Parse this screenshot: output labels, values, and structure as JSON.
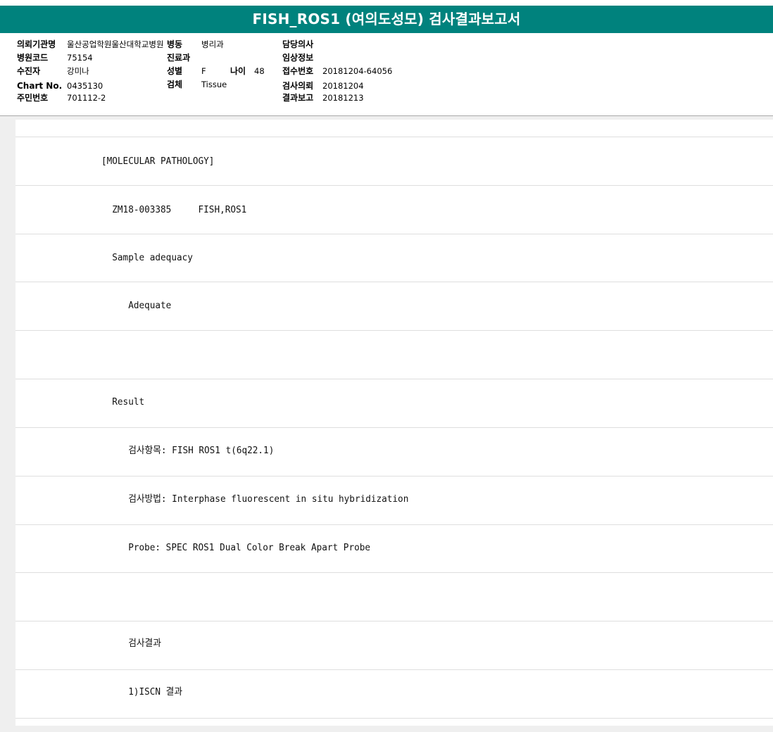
{
  "report": {
    "title": "FISH_ROS1 (여의도성모) 검사결과보고서",
    "header": {
      "col1": [
        {
          "label": "의뢰기관명",
          "value": "울산공업학원울산대학교병원"
        },
        {
          "label": "병원코드",
          "value": "75154"
        },
        {
          "label": "수진자",
          "value": "강미나"
        },
        {
          "label": "Chart No.",
          "value": "0435130"
        },
        {
          "label": "주민번호",
          "value": "701112-2"
        }
      ],
      "col2": {
        "dept_label": "병동",
        "dept_value": "병리과",
        "clinic_label": "진료과",
        "sex_label": "성별",
        "sex_value": "F",
        "age_label": "나이",
        "age_value": "48",
        "specimen_label": "검체",
        "specimen_value": "Tissue"
      },
      "col3": [
        {
          "label": "담당의사",
          "value": ""
        },
        {
          "label": "임상정보",
          "value": ""
        },
        {
          "label": "접수번호",
          "value": "20181204-64056"
        },
        {
          "label": "검사의뢰",
          "value": "20181204"
        },
        {
          "label": "결과보고",
          "value": "20181213"
        }
      ]
    },
    "lines": [
      "",
      "[MOLECULAR PATHOLOGY]",
      "  ZM18-003385     FISH,ROS1",
      "  Sample adequacy",
      "     Adequate",
      "",
      "  Result",
      "     검사항목: FISH ROS1 t(6q22.1)",
      "     검사방법: Interphase fluorescent in situ hybridization",
      "     Probe: SPEC ROS1 Dual Color Break Apart Probe",
      "",
      "     검사결과",
      "     1)ISCN 결과"
    ]
  },
  "colors": {
    "title_bar": "#00827d",
    "title_text": "#ffffff",
    "page_bg": "#efefef",
    "row_divider": "#dedede"
  }
}
